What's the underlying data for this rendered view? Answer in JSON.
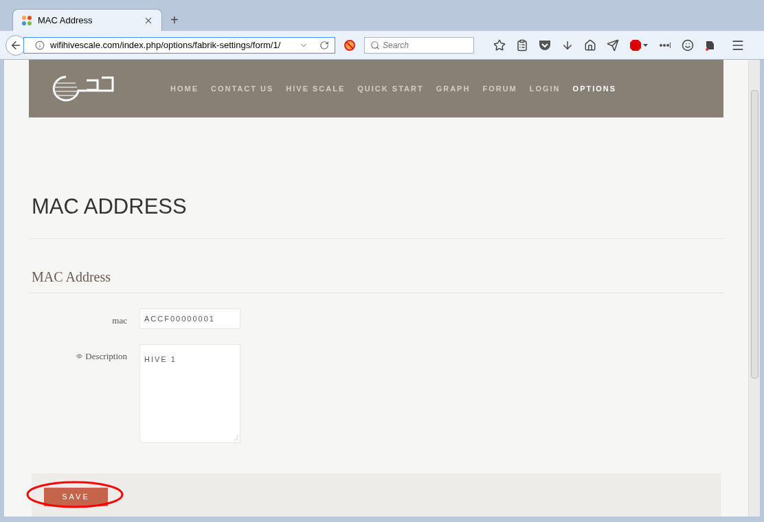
{
  "browser": {
    "tab_title": "MAC Address",
    "new_tab": "+",
    "url": "wifihivescale.com/index.php/options/fabrik-settings/form/1/",
    "search_placeholder": "Search"
  },
  "site_nav": [
    {
      "label": "HOME",
      "selected": false
    },
    {
      "label": "CONTACT US",
      "selected": false
    },
    {
      "label": "HIVE SCALE",
      "selected": false
    },
    {
      "label": "QUICK START",
      "selected": false
    },
    {
      "label": "GRAPH",
      "selected": false
    },
    {
      "label": "FORUM",
      "selected": false
    },
    {
      "label": "LOGIN",
      "selected": false
    },
    {
      "label": "OPTIONS",
      "selected": true
    }
  ],
  "page_title": "MAC ADDRESS",
  "form": {
    "title": "MAC Address",
    "fields": [
      {
        "label": "mac",
        "kind": "input",
        "value": "ACCF00000001"
      },
      {
        "label": "Description",
        "kind": "textarea",
        "value": "HIVE 1"
      }
    ],
    "save_button": "SAVE"
  }
}
